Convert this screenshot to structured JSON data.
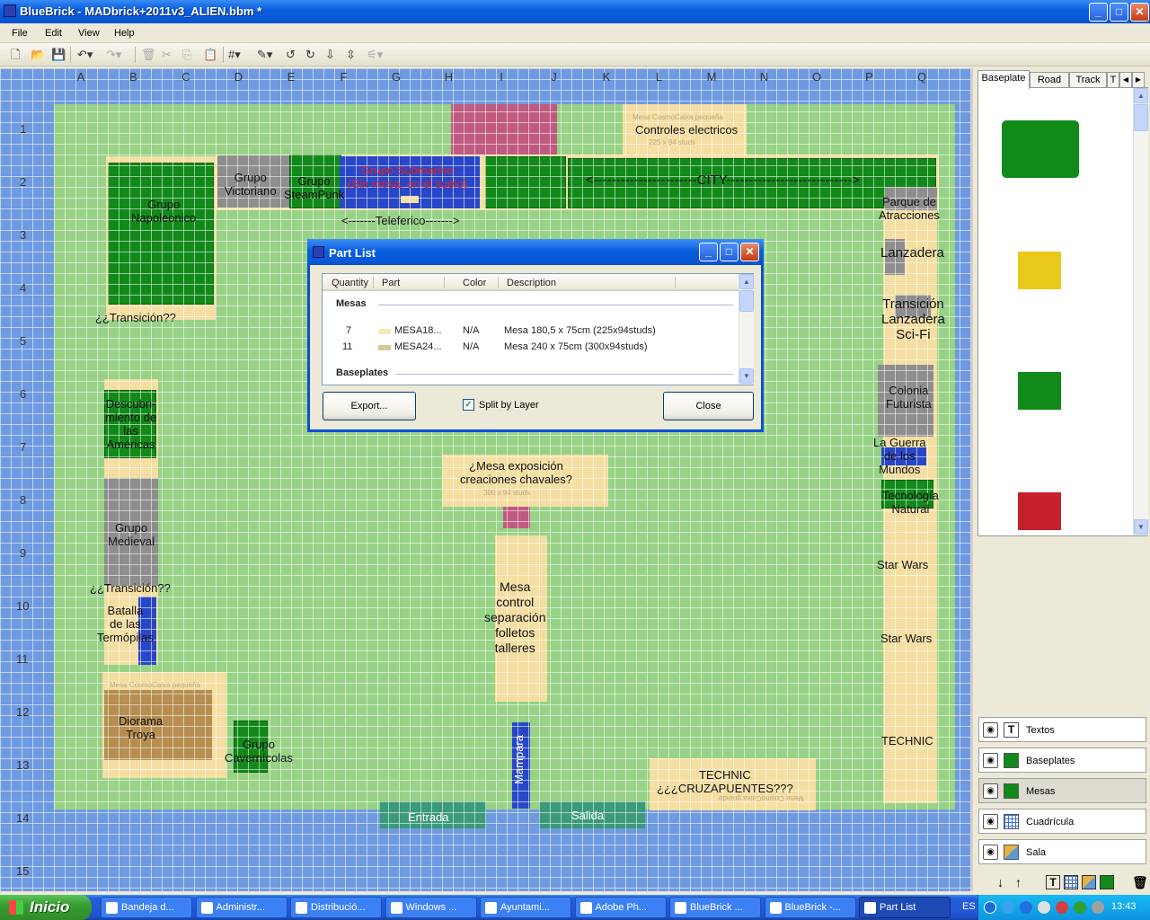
{
  "window": {
    "title": "BlueBrick - MADbrick+2011v3_ALIEN.bbm *",
    "minimize": "_",
    "maximize": "□",
    "close": "✕"
  },
  "menu": [
    "File",
    "Edit",
    "View",
    "Help"
  ],
  "grid": {
    "columns": [
      "A",
      "B",
      "C",
      "D",
      "E",
      "F",
      "G",
      "H",
      "I",
      "J",
      "K",
      "L",
      "M",
      "N",
      "O",
      "P",
      "Q"
    ],
    "rows": [
      "1",
      "2",
      "3",
      "4",
      "5",
      "6",
      "7",
      "8",
      "9",
      "10",
      "11",
      "12",
      "13",
      "14",
      "15"
    ]
  },
  "map": {
    "labels": {
      "controles": "Controles electricos",
      "controles_small": "Mesa CosmoCaixa pequeña",
      "controles_size": "225 x 94 studs",
      "victoriano": "Grupo\nVictoriano",
      "steampunk": "Grupo\nSteamPunk",
      "submarino": "Grupo Submarino\n(Sin mesa, en el suelo)",
      "city": "<-----------------------CITY---------------------------->",
      "teleferico": "<-------Teleferico------->",
      "napoleonico": "Grupo\nNapoleónico",
      "transicion1": "¿¿Transición??",
      "parque": "Parque de\nAtracciones",
      "lanzadera": "Lanzadera",
      "transicion_sci": "Transición\nLanzadera\nSci-Fi",
      "colonia": "Colonia\nFuturista",
      "guerra": "La Guerra\nde los\nMundos",
      "tecnologia": "Tecnología\nNatural",
      "starwars1": "Star Wars",
      "starwars2": "Star Wars",
      "technic": "TECHNIC",
      "descubrimiento": "Descubri-\nmiento de\nlas\nAméricas",
      "medieval": "Grupo\nMedieval",
      "transicion2": "¿¿Transición??",
      "termopilas": "Batalla\nde las\nTermópilas",
      "diorama": "Diorama\nTroya",
      "diorama_small": "Mesa CosmoCaixa pequeña",
      "cavernicolas": "Grupo\nCavernícolas",
      "exposicion": "¿Mesa exposición\ncreaciones chavales?",
      "exposicion_size": "300 x 94 studs",
      "mesa_control": "Mesa\ncontrol\nseparación\nfolletos\ntalleres",
      "mampara": "Mampara",
      "cruzapuentes": "TECHNIC\n¿¿¿CRUZAPUENTES???",
      "cruzapuentes_small": "Mesa CosmoCaixa grande",
      "entrada": "Entrada",
      "salida": "Salida"
    }
  },
  "right_panel": {
    "tabs": [
      "Baseplate",
      "Road",
      "Track",
      "T"
    ],
    "palette_colors": [
      "#118a1a",
      "#e8c81a",
      "#118a1a",
      "#c8202a"
    ],
    "layers": [
      {
        "name": "Textos",
        "icon": "text-layer-icon"
      },
      {
        "name": "Baseplates",
        "icon": "brick-layer-icon"
      },
      {
        "name": "Mesas",
        "icon": "brick-layer-icon"
      },
      {
        "name": "Cuadrícula",
        "icon": "grid-layer-icon"
      },
      {
        "name": "Sala",
        "icon": "area-layer-icon"
      }
    ]
  },
  "dialog": {
    "title": "Part List",
    "columns": [
      "Quantity",
      "Part",
      "Color",
      "Description"
    ],
    "groups": [
      {
        "name": "Mesas",
        "rows": [
          {
            "qty": "7",
            "part": "MESA18...",
            "color": "N/A",
            "desc": "Mesa 180,5 x 75cm (225x94studs)",
            "swatch": "#f5e6b5"
          },
          {
            "qty": "11",
            "part": "MESA24...",
            "color": "N/A",
            "desc": "Mesa 240 x 75cm (300x94studs)",
            "swatch": "#d9c69a"
          }
        ]
      },
      {
        "name": "Baseplates",
        "rows": []
      }
    ],
    "export_label": "Export...",
    "split_label": "Split by Layer",
    "split_checked": true,
    "close_label": "Close"
  },
  "taskbar": {
    "start": "Inicio",
    "tasks": [
      "Bandeja d...",
      "Administr...",
      "Distribució...",
      "Windows ...",
      "Ayuntami...",
      "Adobe Ph...",
      "BlueBrick ...",
      "BlueBrick -...",
      "Part List"
    ],
    "language": "ES",
    "clock": "13:43"
  }
}
